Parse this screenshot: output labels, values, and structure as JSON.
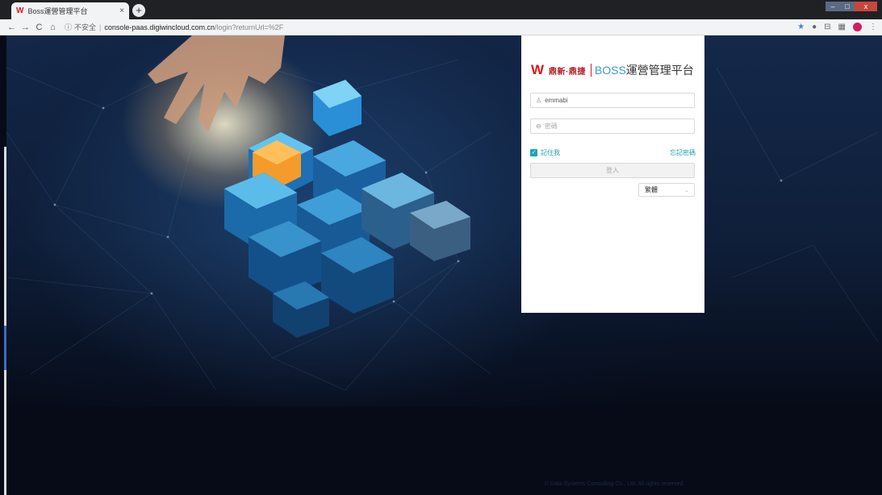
{
  "browser": {
    "tab": {
      "title": "Boss運營管理平台",
      "close": "×"
    },
    "new_tab": "+",
    "window_controls": {
      "min": "–",
      "max": "□",
      "close": "x"
    },
    "nav": {
      "back": "←",
      "forward": "→",
      "reload": "C",
      "home": "⌂"
    },
    "address": {
      "info": "ⓘ",
      "security_label": "不安全",
      "separator": "|",
      "host": "console-paas.digiwincloud.com.cn",
      "path": "/login?returnUrl=%2F"
    },
    "extensions": {
      "star": "★",
      "ext1": "●",
      "ext2": "⊟",
      "ext3": "▦",
      "ext4": "●",
      "menu": "⋮"
    }
  },
  "login": {
    "brand": {
      "logo_mark": "W",
      "logo_text": "鼎新·鼎捷",
      "title": "BOSS",
      "title_suffix": "運營管理平台"
    },
    "username": {
      "icon": "♙",
      "value": "emmabi",
      "placeholder": ""
    },
    "password": {
      "icon": "⊖",
      "value": "",
      "placeholder": "密碼"
    },
    "remember": {
      "checked_mark": "✓",
      "label": "記住我"
    },
    "forgot_password": "忘記密碼",
    "submit_label": "登入",
    "language": {
      "value": "繁體",
      "chevron": "⌄"
    }
  },
  "footer": "© Data Systems Consulting Co., Ltd. All rights reserved.",
  "colors": {
    "brand_red": "#d7191e",
    "accent_teal": "#1aa6b7",
    "boss_blue": "#3a9bd5"
  }
}
